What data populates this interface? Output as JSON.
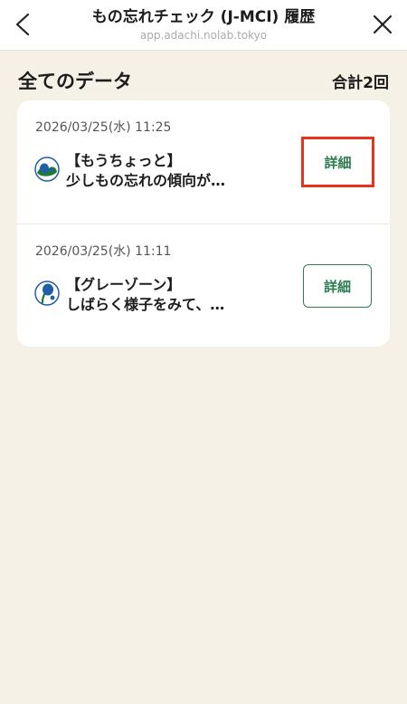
{
  "header": {
    "title": "もの忘れチェック (J-MCI) 履歴",
    "url": "app.adachi.nolab.tokyo",
    "back_icon": "chevron-left-icon",
    "close_icon": "close-icon"
  },
  "section": {
    "title": "全てのデータ",
    "total": "合計2回"
  },
  "records": [
    {
      "date": "2026/03/25(水) 11:25",
      "result_tag": "【もうちょっと】",
      "result_text": "少しもの忘れの傾向が…",
      "detail_label": "詳細",
      "avatar_icon": "result-mascot-icon"
    },
    {
      "date": "2026/03/25(水) 11:11",
      "result_tag": "【グレーゾーン】",
      "result_text": "しばらく様子をみて、…",
      "detail_label": "詳細",
      "avatar_icon": "result-mascot-icon"
    }
  ],
  "colors": {
    "background": "#f6f1e6",
    "accent_green": "#2d7d51",
    "highlight_red": "#e8321e"
  }
}
